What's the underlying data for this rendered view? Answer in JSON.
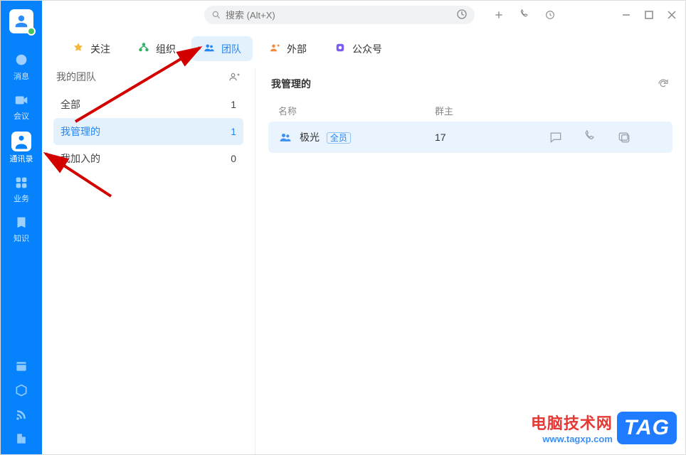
{
  "search": {
    "placeholder": "搜索 (Alt+X)"
  },
  "sidebar": {
    "items": [
      {
        "label": "消息"
      },
      {
        "label": "会议"
      },
      {
        "label": "通讯录"
      },
      {
        "label": "业务"
      },
      {
        "label": "知识"
      }
    ]
  },
  "tabs": [
    {
      "label": "关注",
      "icon": "star"
    },
    {
      "label": "组织",
      "icon": "org"
    },
    {
      "label": "团队",
      "icon": "team"
    },
    {
      "label": "外部",
      "icon": "ext"
    },
    {
      "label": "公众号",
      "icon": "pub"
    }
  ],
  "leftcol": {
    "title": "我的团队",
    "filters": [
      {
        "label": "全部",
        "count": "1"
      },
      {
        "label": "我管理的",
        "count": "1"
      },
      {
        "label": "我加入的",
        "count": "0"
      }
    ]
  },
  "rightcol": {
    "title": "我管理的",
    "columns": {
      "name": "名称",
      "owner": "群主"
    },
    "rows": [
      {
        "name": "极光",
        "badge": "全员",
        "owner": "17"
      }
    ]
  },
  "watermark": {
    "line1": "电脑技术网",
    "line2": "www.tagxp.com",
    "badge": "TAG"
  }
}
